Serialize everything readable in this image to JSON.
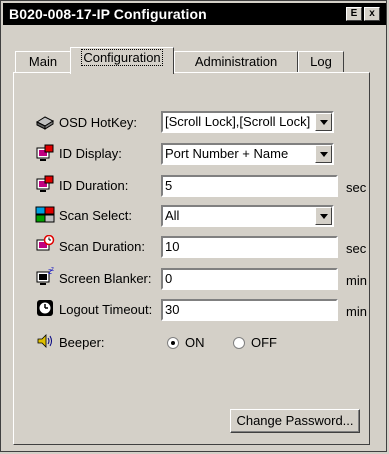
{
  "window": {
    "title": "B020-008-17-IP Configuration",
    "help_glyph": "E",
    "close_glyph": "x"
  },
  "tabs": [
    {
      "label": "Main",
      "active": false
    },
    {
      "label": "Configuration",
      "active": true
    },
    {
      "label": "Administration",
      "active": false
    },
    {
      "label": "Log",
      "active": false
    }
  ],
  "form": {
    "osd_hotkey": {
      "label": "OSD HotKey:",
      "value": "[Scroll Lock],[Scroll Lock]"
    },
    "id_display": {
      "label": "ID Display:",
      "value": "Port Number + Name"
    },
    "id_duration": {
      "label": "ID Duration:",
      "value": "5",
      "unit": "sec"
    },
    "scan_select": {
      "label": "Scan Select:",
      "value": "All"
    },
    "scan_duration": {
      "label": "Scan Duration:",
      "value": "10",
      "unit": "sec"
    },
    "screen_blanker": {
      "label": "Screen Blanker:",
      "value": "0",
      "unit": "min"
    },
    "logout_timeout": {
      "label": "Logout Timeout:",
      "value": "30",
      "unit": "min"
    },
    "beeper": {
      "label": "Beeper:",
      "on_label": "ON",
      "off_label": "OFF",
      "selected": "ON"
    }
  },
  "buttons": {
    "change_password": "Change Password..."
  },
  "icons": [
    "keyboard-icon",
    "id-display-icon",
    "id-duration-icon",
    "scan-select-icon",
    "scan-duration-icon",
    "screen-blanker-icon",
    "clock-icon",
    "speaker-icon"
  ]
}
